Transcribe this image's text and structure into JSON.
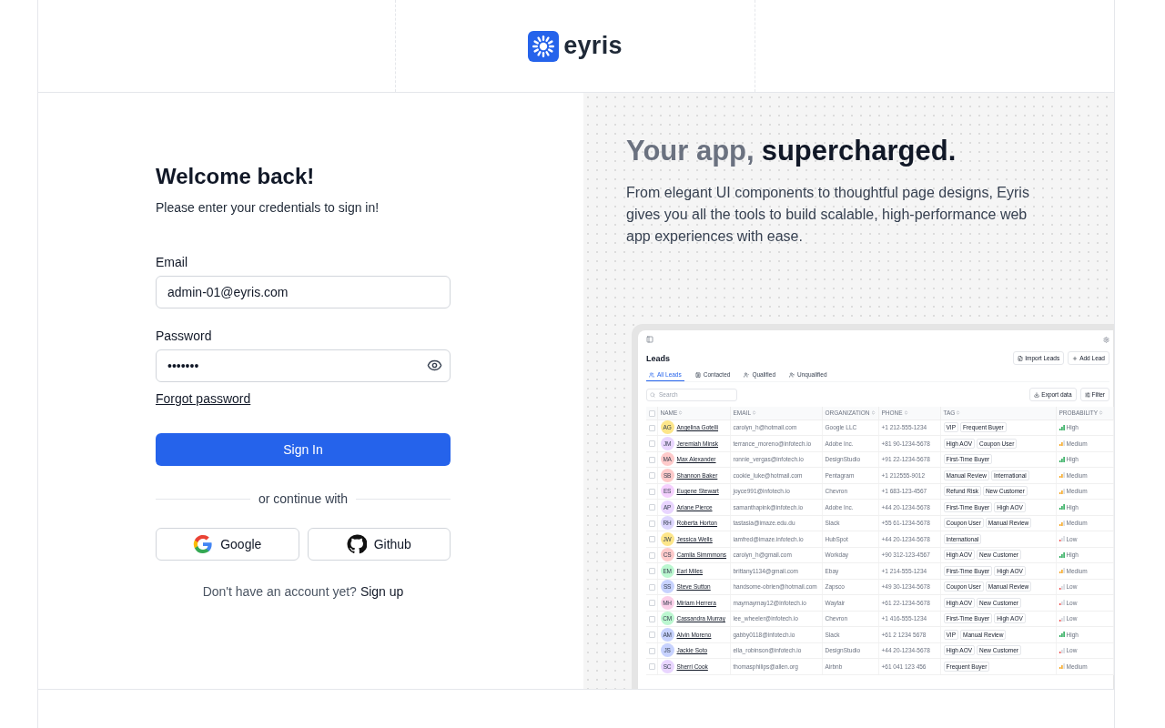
{
  "logo": {
    "name": "eyris"
  },
  "signin": {
    "title": "Welcome back!",
    "subtitle": "Please enter your credentials to sign in!",
    "email": {
      "label": "Email",
      "value": "admin-01@eyris.com"
    },
    "password": {
      "label": "Password",
      "value": "•••••••"
    },
    "forgot": "Forgot password",
    "submit": "Sign In",
    "divider": "or continue with",
    "providers": [
      {
        "kind": "google",
        "label": "Google"
      },
      {
        "kind": "github",
        "label": "Github"
      }
    ],
    "signup_prompt": "Don't have an account yet?",
    "signup_link": "Sign up"
  },
  "promo": {
    "title_muted": "Your app,",
    "title_strong": "supercharged.",
    "text": "From elegant UI components to thoughtful page designs, Eyris gives you all the tools to build scalable, high-performance web app experiences with ease."
  },
  "preview": {
    "title": "Leads",
    "actions": [
      {
        "kind": "import",
        "label": "Import Leads"
      },
      {
        "kind": "add",
        "label": "Add Lead"
      }
    ],
    "tabs": [
      {
        "kind": "all",
        "label": "All Leads",
        "selected": true
      },
      {
        "kind": "contacted",
        "label": "Contacted",
        "selected": false
      },
      {
        "kind": "qualified",
        "label": "Qualified",
        "selected": false
      },
      {
        "kind": "unqualified",
        "label": "Unqualified",
        "selected": false
      }
    ],
    "search": {
      "placeholder": "Search"
    },
    "tools": [
      {
        "kind": "export",
        "label": "Export data"
      },
      {
        "kind": "filter",
        "label": "Filter"
      }
    ],
    "all_checked": false,
    "columns": [
      "NAME",
      "EMAIL",
      "ORGANIZATION",
      "PHONE",
      "TAG",
      "PROBABILITY"
    ],
    "rows": [
      {
        "checked": false,
        "initials": "AG",
        "color": "#fde68a",
        "name": "Angelina Gotelli",
        "email": "carolyn_h@hotmail.com",
        "org": "Google LLC",
        "phone": "+1 212-555-1234",
        "tags": [
          "VIP",
          "Frequent Buyer"
        ],
        "probability": {
          "kind": "high",
          "label": "High"
        }
      },
      {
        "checked": false,
        "initials": "JM",
        "color": "#e9d5ff",
        "name": "Jeremiah Minsk",
        "email": "terrance_moreno@infotech.io",
        "org": "Adobe Inc.",
        "phone": "+81 90-1234-5678",
        "tags": [
          "High AOV",
          "Coupon User"
        ],
        "probability": {
          "kind": "medium",
          "label": "Medium"
        }
      },
      {
        "checked": false,
        "initials": "MA",
        "color": "#fecaca",
        "name": "Max Alexander",
        "email": "ronnie_vergas@infotech.io",
        "org": "DesignStudio",
        "phone": "+91 22-1234-5678",
        "tags": [
          "First-Time Buyer"
        ],
        "probability": {
          "kind": "high",
          "label": "High"
        }
      },
      {
        "checked": false,
        "initials": "SB",
        "color": "#fecaca",
        "name": "Shannon Baker",
        "email": "cookie_luke@hotmail.com",
        "org": "Pentagram",
        "phone": "+1 212555-9012",
        "tags": [
          "Manual Review",
          "International"
        ],
        "probability": {
          "kind": "medium",
          "label": "Medium"
        }
      },
      {
        "checked": false,
        "initials": "ES",
        "color": "#f5d0fe",
        "name": "Eugene Stewart",
        "email": "joyce991@infotech.io",
        "org": "Chevron",
        "phone": "+1 683-123-4567",
        "tags": [
          "Refund Risk",
          "New Customer"
        ],
        "probability": {
          "kind": "medium",
          "label": "Medium"
        }
      },
      {
        "checked": false,
        "initials": "AP",
        "color": "#e9d5ff",
        "name": "Ariane Pierce",
        "email": "samanthapink@infotech.io",
        "org": "Adobe Inc.",
        "phone": "+44 20-1234-5678",
        "tags": [
          "First-Time Buyer",
          "High AOV"
        ],
        "probability": {
          "kind": "high",
          "label": "High"
        }
      },
      {
        "checked": false,
        "initials": "RH",
        "color": "#ddd6fe",
        "name": "Roberta Horton",
        "email": "tastasia@imaze.edu.du",
        "org": "Slack",
        "phone": "+55 61-1234-5678",
        "tags": [
          "Coupon User",
          "Manual Review"
        ],
        "probability": {
          "kind": "medium",
          "label": "Medium"
        }
      },
      {
        "checked": false,
        "initials": "JW",
        "color": "#fde68a",
        "name": "Jessica Wells",
        "email": "iamfred@imaze.infotech.io",
        "org": "HubSpot",
        "phone": "+44 20-1234-5678",
        "tags": [
          "International"
        ],
        "probability": {
          "kind": "low",
          "label": "Low"
        }
      },
      {
        "checked": false,
        "initials": "CS",
        "color": "#fecaca",
        "name": "Camila Simmmons",
        "email": "carolyn_h@gmail.com",
        "org": "Workday",
        "phone": "+90 312-123-4567",
        "tags": [
          "High AOV",
          "New Customer"
        ],
        "probability": {
          "kind": "high",
          "label": "High"
        }
      },
      {
        "checked": false,
        "initials": "EM",
        "color": "#bbf7d0",
        "name": "Earl Miles",
        "email": "brittany1134@gmail.com",
        "org": "Ebay",
        "phone": "+1 214-555-1234",
        "tags": [
          "First-Time Buyer",
          "High AOV"
        ],
        "probability": {
          "kind": "medium",
          "label": "Medium"
        }
      },
      {
        "checked": false,
        "initials": "SS",
        "color": "#c7d2fe",
        "name": "Steve Sutton",
        "email": "handsome-obrien@hotmail.com",
        "org": "Zapsco",
        "phone": "+49 30-1234-5678",
        "tags": [
          "Coupon User",
          "Manual Review"
        ],
        "probability": {
          "kind": "low",
          "label": "Low"
        }
      },
      {
        "checked": false,
        "initials": "MH",
        "color": "#fbcfe8",
        "name": "Miriam Herrera",
        "email": "maymaymay12@infotech.io",
        "org": "Wayfair",
        "phone": "+61 22-1234-5678",
        "tags": [
          "High AOV",
          "New Customer"
        ],
        "probability": {
          "kind": "low",
          "label": "Low"
        }
      },
      {
        "checked": false,
        "initials": "CM",
        "color": "#bbf7d0",
        "name": "Cassandra Murray",
        "email": "lee_wheeler@infotech.io",
        "org": "Chevron",
        "phone": "+1 416-555-1234",
        "tags": [
          "First-Time Buyer",
          "High AOV"
        ],
        "probability": {
          "kind": "low",
          "label": "Low"
        }
      },
      {
        "checked": false,
        "initials": "AM",
        "color": "#c7d2fe",
        "name": "Alvin Moreno",
        "email": "gabby0118@infotech.io",
        "org": "Slack",
        "phone": "+61 2 1234 5678",
        "tags": [
          "VIP",
          "Manual Review"
        ],
        "probability": {
          "kind": "high",
          "label": "High"
        }
      },
      {
        "checked": false,
        "initials": "JS",
        "color": "#c7d2fe",
        "name": "Jackie Soto",
        "email": "ella_robinson@infotech.io",
        "org": "DesignStudio",
        "phone": "+44 20-1234-5678",
        "tags": [
          "High AOV",
          "New Customer"
        ],
        "probability": {
          "kind": "low",
          "label": "Low"
        }
      },
      {
        "checked": false,
        "initials": "SC",
        "color": "#e9d5ff",
        "name": "Sherri Cook",
        "email": "thomasphilips@allen.org",
        "org": "Airbnb",
        "phone": "+61 041 123 456",
        "tags": [
          "Frequent Buyer"
        ],
        "probability": {
          "kind": "medium",
          "label": "Medium"
        }
      }
    ]
  }
}
